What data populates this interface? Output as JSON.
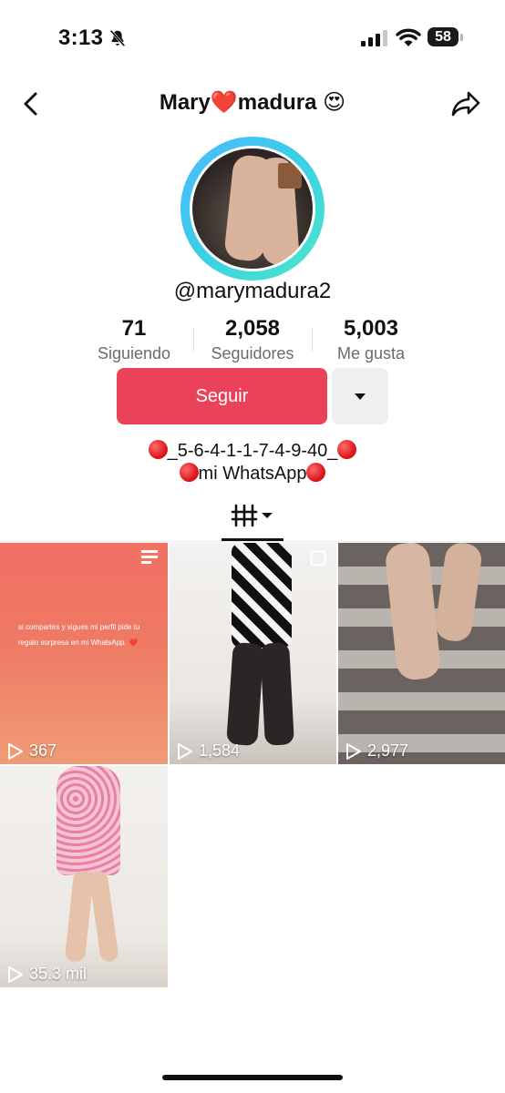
{
  "status_bar": {
    "time": "3:13",
    "battery": "58"
  },
  "header": {
    "title": "Mary❤️madura 😍"
  },
  "profile": {
    "username": "@marymadura2",
    "stats": [
      {
        "value": "71",
        "label": "Siguiendo"
      },
      {
        "value": "2,058",
        "label": "Seguidores"
      },
      {
        "value": "5,003",
        "label": "Me gusta"
      }
    ],
    "follow_label": "Seguir",
    "bio_line1": "_5-6-4-1-1-7-4-9-40_",
    "bio_line2": "mi WhatsApp"
  },
  "videos": [
    {
      "views": "367",
      "caption": "si compartes y sigues mi perfil pide tu regalo sorpresa en mi WhatsApp. ❤️"
    },
    {
      "views": "1,584"
    },
    {
      "views": "2,977"
    },
    {
      "views": "35.3 mil"
    }
  ],
  "colors": {
    "accent": "#ea4359",
    "ring_start": "#4db8ff",
    "ring_end": "#4ee7c8"
  }
}
